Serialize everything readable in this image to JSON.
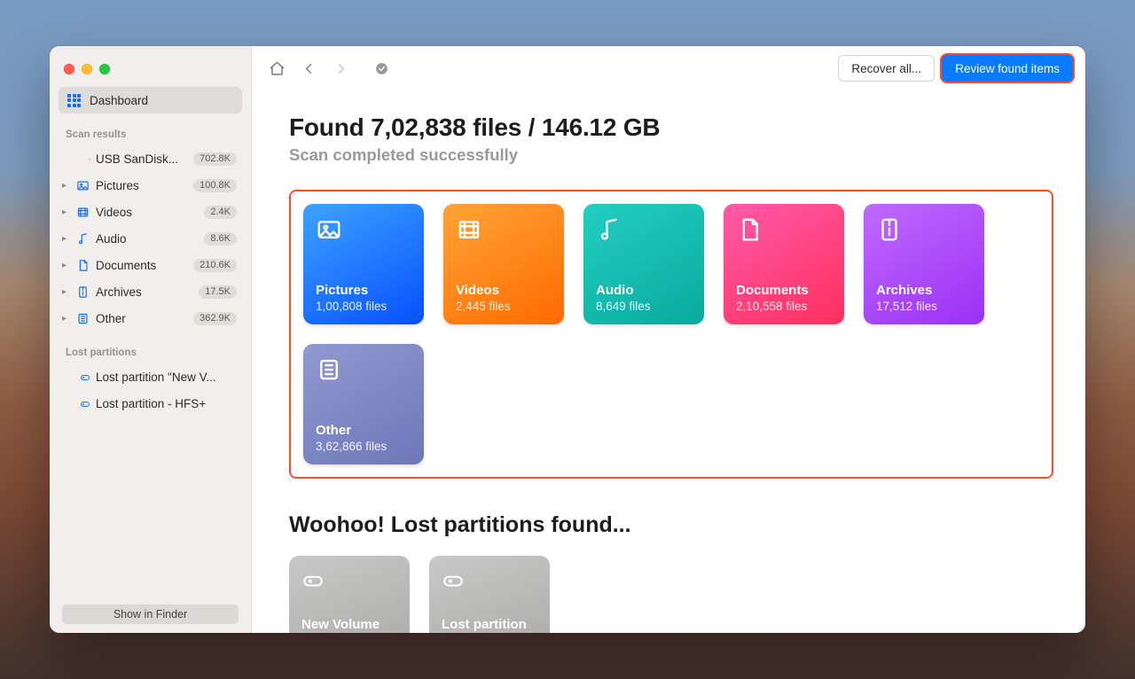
{
  "traffic": {
    "close": "close",
    "min": "minimize",
    "max": "maximize"
  },
  "sidebar": {
    "dashboard_label": "Dashboard",
    "section_scan": "Scan results",
    "section_lost": "Lost partitions",
    "items": [
      {
        "label": "USB  SanDisk...",
        "badge": "702.8K",
        "icon": "drive",
        "indent": 1
      },
      {
        "label": "Pictures",
        "badge": "100.8K",
        "icon": "image",
        "indent": 0
      },
      {
        "label": "Videos",
        "badge": "2.4K",
        "icon": "film",
        "indent": 0
      },
      {
        "label": "Audio",
        "badge": "8.6K",
        "icon": "note",
        "indent": 0
      },
      {
        "label": "Documents",
        "badge": "210.6K",
        "icon": "doc",
        "indent": 0
      },
      {
        "label": "Archives",
        "badge": "17.5K",
        "icon": "zip",
        "indent": 0
      },
      {
        "label": "Other",
        "badge": "362.9K",
        "icon": "other",
        "indent": 0
      }
    ],
    "lost": [
      {
        "label": "Lost partition \"New V..."
      },
      {
        "label": "Lost partition - HFS+"
      }
    ],
    "show_in_finder": "Show in Finder"
  },
  "toolbar": {
    "recover": "Recover all...",
    "review": "Review found items"
  },
  "headline": {
    "title": "Found 7,02,838 files / 146.12 GB",
    "subtitle": "Scan completed successfully"
  },
  "cards": [
    {
      "name": "Pictures",
      "count": "1,00,808 files",
      "cls": "c-blue",
      "icon": "image"
    },
    {
      "name": "Videos",
      "count": "2,445 files",
      "cls": "c-orange",
      "icon": "film"
    },
    {
      "name": "Audio",
      "count": "8,649 files",
      "cls": "c-teal",
      "icon": "note"
    },
    {
      "name": "Documents",
      "count": "2,10,558 files",
      "cls": "c-pink",
      "icon": "doc"
    },
    {
      "name": "Archives",
      "count": "17,512 files",
      "cls": "c-purple",
      "icon": "zip"
    },
    {
      "name": "Other",
      "count": "3,62,866 files",
      "cls": "c-slate",
      "icon": "other"
    }
  ],
  "partitions": {
    "heading": "Woohoo! Lost partitions found...",
    "items": [
      {
        "name": "New Volume"
      },
      {
        "name": "Lost partition"
      }
    ]
  }
}
